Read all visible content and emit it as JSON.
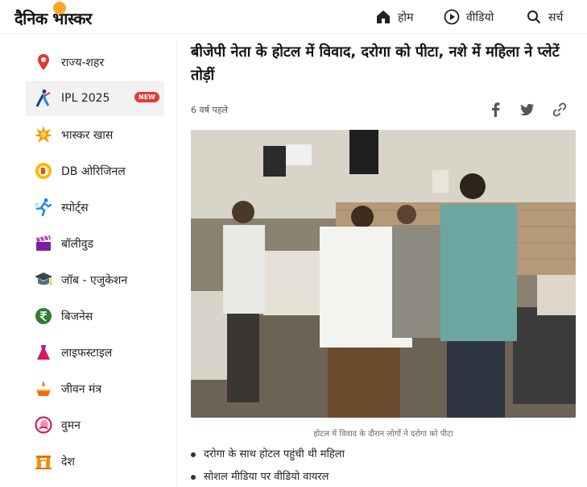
{
  "header": {
    "logo": "दैनिक भास्कर",
    "nav": [
      {
        "label": "होम",
        "icon": "home-icon"
      },
      {
        "label": "वीडियो",
        "icon": "play-icon"
      },
      {
        "label": "सर्च",
        "icon": "search-icon"
      }
    ]
  },
  "sidebar": {
    "items": [
      {
        "label": "राज्य-शहर",
        "icon": "location-pin-icon"
      },
      {
        "label": "IPL 2025",
        "icon": "cricket-player-icon",
        "badge": "NEW"
      },
      {
        "label": "भास्कर खास",
        "icon": "star-burst-icon"
      },
      {
        "label": "DB ओरिजिनल",
        "icon": "db-original-icon"
      },
      {
        "label": "स्पोर्ट्स",
        "icon": "runner-icon"
      },
      {
        "label": "बॉलीवुड",
        "icon": "clapperboard-icon"
      },
      {
        "label": "जॉब - एजुकेशन",
        "icon": "graduation-cap-icon"
      },
      {
        "label": "बिजनेस",
        "icon": "rupee-icon"
      },
      {
        "label": "लाइफस्टाइल",
        "icon": "dress-icon"
      },
      {
        "label": "जीवन मंत्र",
        "icon": "diya-icon"
      },
      {
        "label": "वुमन",
        "icon": "women-icon"
      },
      {
        "label": "देश",
        "icon": "india-gate-icon"
      }
    ]
  },
  "article": {
    "headline": "बीजेपी नेता के होटल में विवाद, दरोगा को पीटा, नशे में महिला ने प्लेटें तोड़ीं",
    "time": "6 वर्ष पहले",
    "share": [
      "facebook-icon",
      "twitter-icon",
      "link-icon"
    ],
    "caption": "होटल में विवाद के दौरान लोगों ने दरोगा को पीटा",
    "bullets": [
      "दरोगा के साथ होटल पहुंची थी महिला",
      "सोशल मीडिया पर वीडियो वायरल"
    ]
  },
  "colors": {
    "accent_red": "#e53935",
    "logo_sun": "#ffa726",
    "active_bg": "#f2f2f2"
  }
}
